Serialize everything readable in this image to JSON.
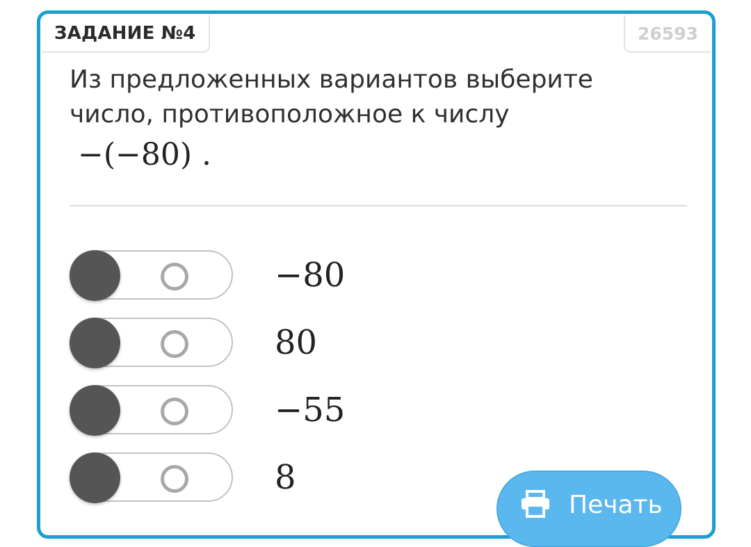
{
  "task": {
    "label": "ЗАДАНИЕ №4",
    "id": "26593"
  },
  "question": {
    "text": "Из предложенных вариантов выберите число, противоположное к числу",
    "formula": "−(−80) ."
  },
  "options": [
    {
      "value": "−80"
    },
    {
      "value": "80"
    },
    {
      "value": "−55"
    },
    {
      "value": "8"
    }
  ],
  "print_button": {
    "label": "Печать",
    "icon": "printer-icon"
  },
  "colors": {
    "card_border": "#1a9fd0",
    "knob": "#555555",
    "print_button": "#5bb8ee"
  }
}
